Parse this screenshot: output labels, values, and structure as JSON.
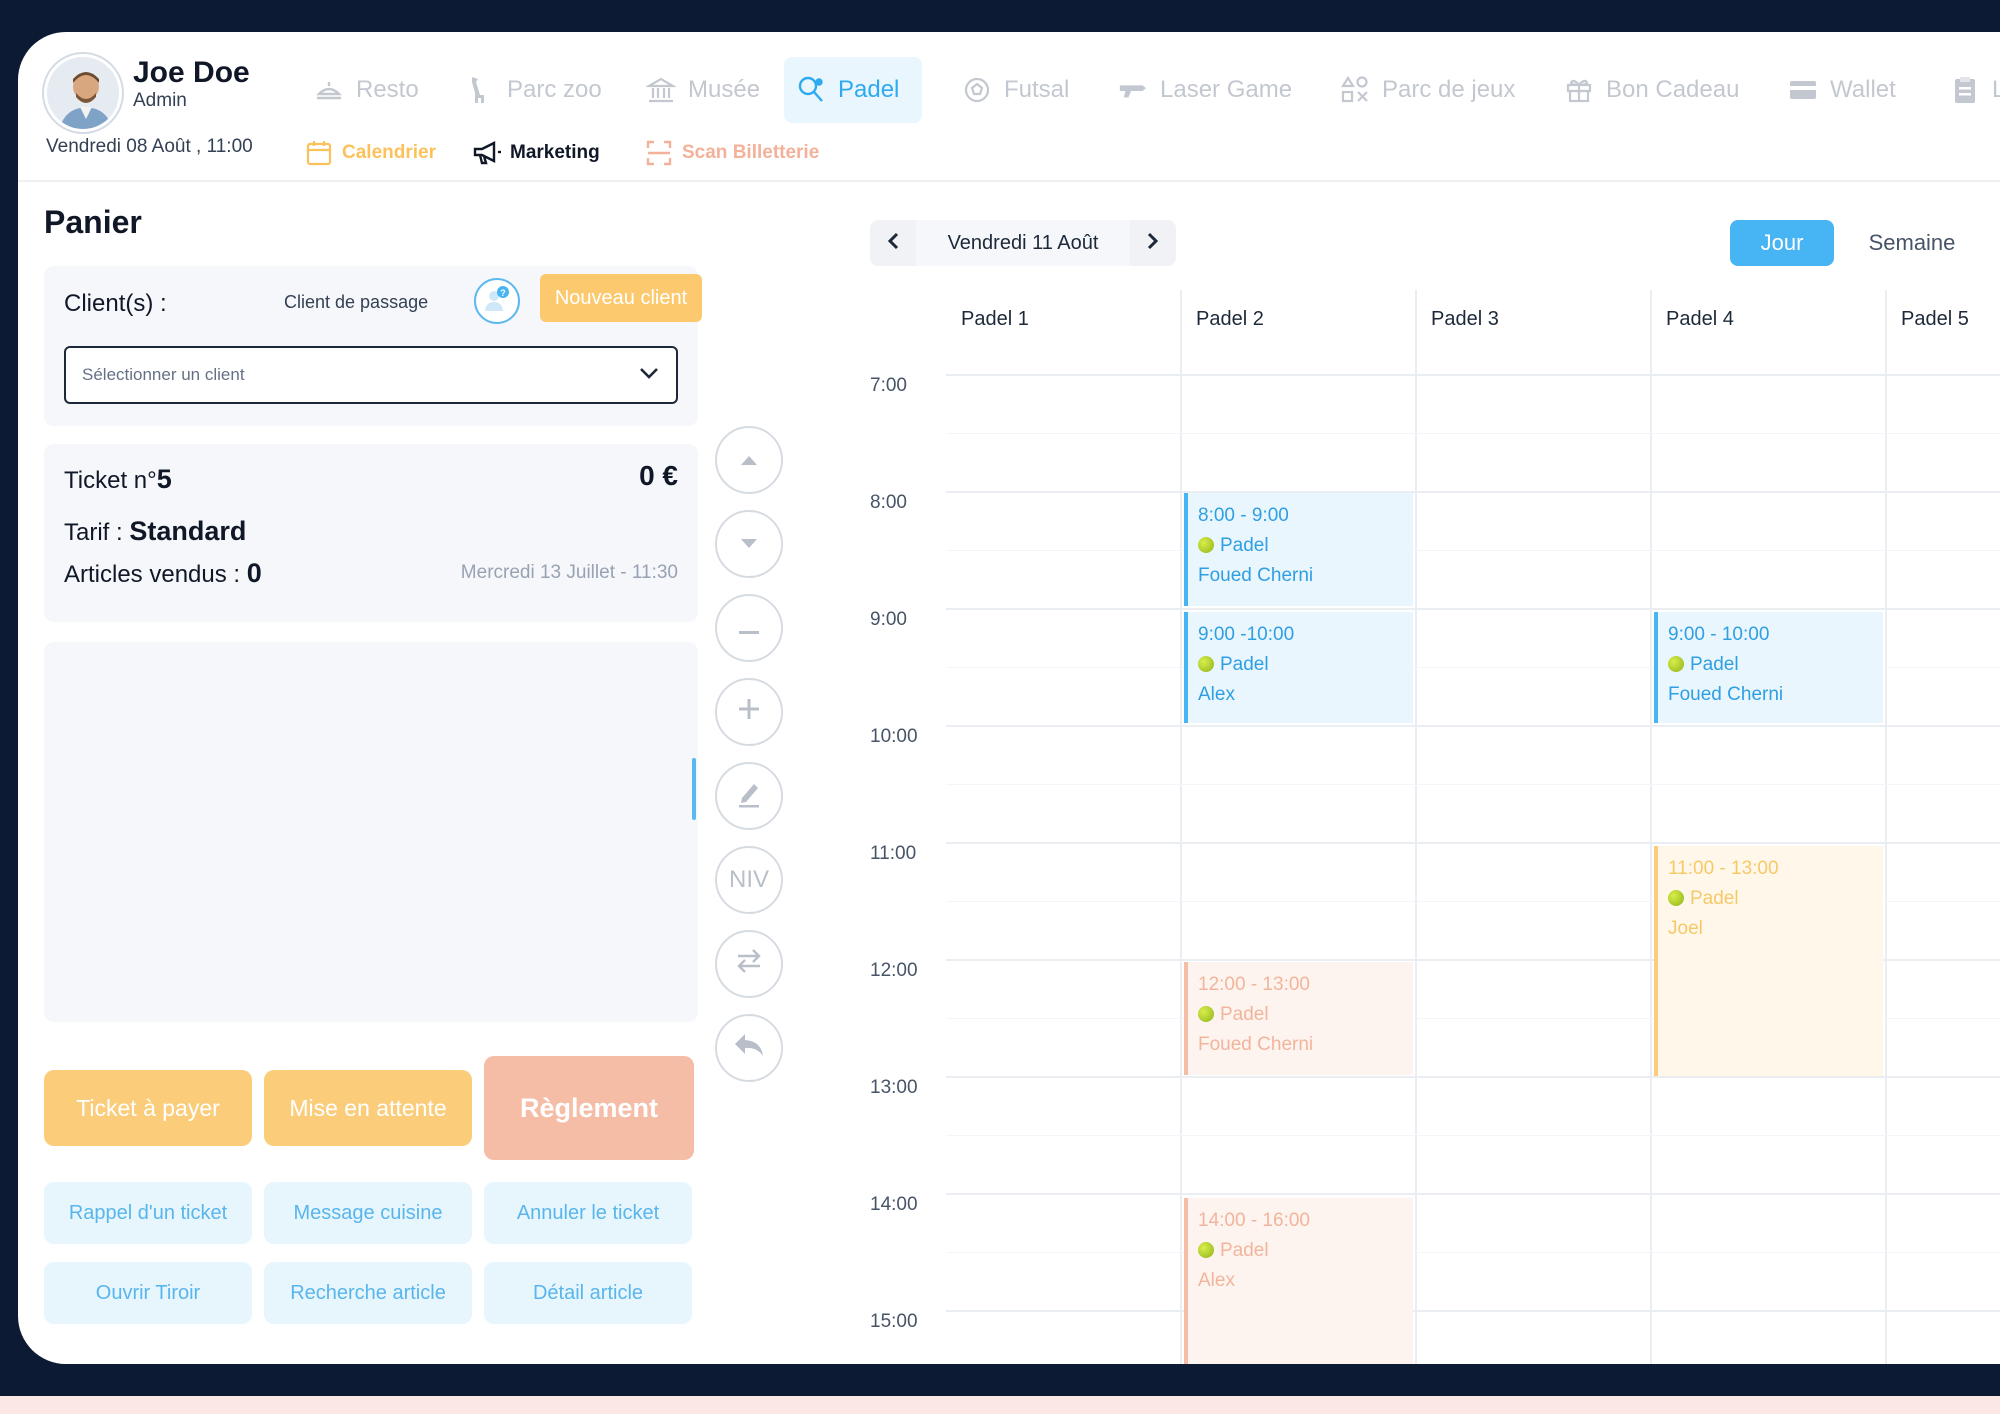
{
  "user": {
    "name": "Joe Doe",
    "role": "Admin",
    "datetime": "Vendredi 08 Août , 11:00"
  },
  "nav": {
    "items": [
      {
        "label": "Resto",
        "icon": "resto-icon"
      },
      {
        "label": "Parc zoo",
        "icon": "giraffe-icon"
      },
      {
        "label": "Musée",
        "icon": "museum-icon"
      },
      {
        "label": "Padel",
        "icon": "padel-icon",
        "active": true
      },
      {
        "label": "Futsal",
        "icon": "football-icon"
      },
      {
        "label": "Laser Game",
        "icon": "laser-gun-icon"
      },
      {
        "label": "Parc de jeux",
        "icon": "games-icon"
      },
      {
        "label": "Bon Cadeau",
        "icon": "gift-icon"
      },
      {
        "label": "Wallet",
        "icon": "wallet-icon"
      },
      {
        "label": "Lis",
        "icon": "clipboard-icon"
      }
    ],
    "sub": [
      {
        "label": "Calendrier",
        "icon": "calendar-icon",
        "color": "#fbc25c"
      },
      {
        "label": "Marketing",
        "icon": "megaphone-icon",
        "color": "#101828"
      },
      {
        "label": "Scan Billetterie",
        "icon": "scan-icon",
        "color": "#f4b19a"
      }
    ]
  },
  "cart": {
    "title": "Panier",
    "client_label": "Client(s) :",
    "passage_label": "Client de passage",
    "new_client": "Nouveau client",
    "select_placeholder": "Sélectionner un client",
    "ticket_prefix": "Ticket n°",
    "ticket_number": "5",
    "amount": "0 €",
    "tarif_prefix": "Tarif : ",
    "tarif": "Standard",
    "articles_prefix": "Articles vendus : ",
    "articles": "0",
    "ticket_date": "Mercredi 13 Juillet - 11:30"
  },
  "controls": {
    "niv_label": "NIV"
  },
  "actions": {
    "ticket_a_payer": "Ticket à payer",
    "mise_en_attente": "Mise en attente",
    "reglement": "Règlement",
    "rappel": "Rappel d'un ticket",
    "message": "Message cuisine",
    "annuler": "Annuler le ticket",
    "tiroir": "Ouvrir Tiroir",
    "recherche": "Recherche article",
    "detail": "Détail article"
  },
  "calendar": {
    "date": "Vendredi 11 Août",
    "view_day": "Jour",
    "view_week": "Semaine",
    "courts": [
      "Padel 1",
      "Padel 2",
      "Padel 3",
      "Padel 4",
      "Padel 5"
    ],
    "times": [
      "7:00",
      "8:00",
      "9:00",
      "10:00",
      "11:00",
      "12:00",
      "13:00",
      "14:00",
      "15:00"
    ],
    "events": [
      {
        "time": "8:00 - 9:00",
        "activity": "Padel",
        "name": "Foued Cherni",
        "color": "blue"
      },
      {
        "time": "9:00 -10:00",
        "activity": "Padel",
        "name": "Alex",
        "color": "blue"
      },
      {
        "time": "9:00 - 10:00",
        "activity": "Padel",
        "name": "Foued Cherni",
        "color": "blue"
      },
      {
        "time": "11:00 - 13:00",
        "activity": "Padel",
        "name": "Joel",
        "color": "yellow"
      },
      {
        "time": "12:00 - 13:00",
        "activity": "Padel",
        "name": "Foued Cherni",
        "color": "salmon"
      },
      {
        "time": "14:00 - 16:00",
        "activity": "Padel",
        "name": "Alex",
        "color": "salmon"
      }
    ]
  }
}
